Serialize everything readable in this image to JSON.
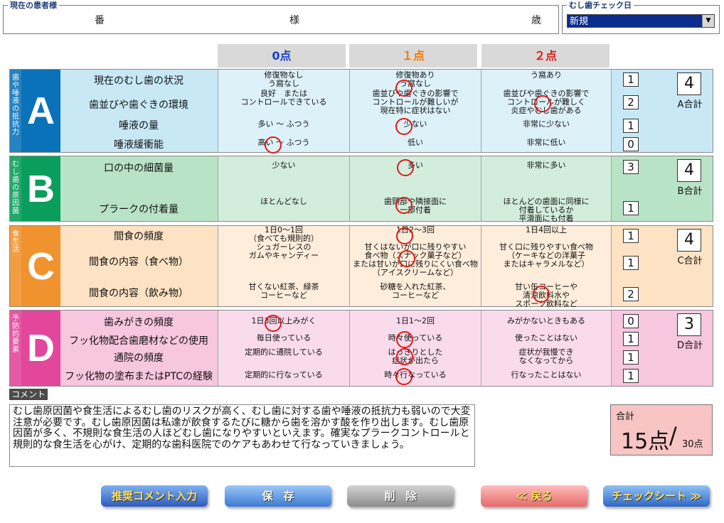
{
  "patient": {
    "legend": "現在の患者様",
    "number_suffix": "番",
    "name_suffix": "様",
    "age_suffix": "歳"
  },
  "check_date": {
    "legend": "むし歯チェック日",
    "selected": "新規"
  },
  "columns": {
    "zero": "0点",
    "one": "１点",
    "two": "２点",
    "zero_color": "#1a3ec2",
    "one_color": "#f07800",
    "two_color": "#e01818"
  },
  "sections": [
    {
      "letter": "A",
      "vertical_label": "歯や唾液の抵抗力",
      "label_color": "#0a72b8",
      "bg_color": "#c8e8f6",
      "items": [
        "現在のむし歯の状況",
        "歯並びや歯ぐきの環境",
        "唾液の量",
        "唾液緩衝能"
      ],
      "options": [
        [
          "修復物なし\nう窩なし",
          "修復物あり\nう窩なし",
          "う窩あり"
        ],
        [
          "良好　または\nコントロールできている",
          "歯並びや歯ぐきの影響で\nコントロールが難しいが\n現在特に症状はない",
          "歯並びや歯ぐきの影響で\nコントロールが難しく\n炎症やむし歯がある"
        ],
        [
          "多い ～ ふつう",
          "少ない",
          "非常に少ない"
        ],
        [
          "高い ～ ふつう",
          "低い",
          "非常に低い"
        ]
      ],
      "scores": [
        "1",
        "2",
        "1",
        "0"
      ],
      "total": "4",
      "total_label": "A合計"
    },
    {
      "letter": "B",
      "vertical_label": "むし歯の原因菌",
      "label_color": "#0a9e5c",
      "bg_color": "#b9e3c7",
      "items": [
        "口の中の細菌量",
        "プラークの付着量"
      ],
      "options": [
        [
          "少ない",
          "多い",
          "非常に多い"
        ],
        [
          "ほとんどなし",
          "歯頸部や隣接面に\n一部付着",
          "ほとんどの歯面に同様に\n付着しているか\n平滑面にも付着"
        ]
      ],
      "scores": [
        "3",
        "1"
      ],
      "total": "4",
      "total_label": "B合計"
    },
    {
      "letter": "C",
      "vertical_label": "食生活",
      "label_color": "#f0922e",
      "bg_color": "#fde2c4",
      "items": [
        "間食の頻度",
        "間食の内容（食べ物）",
        "間食の内容（飲み物）"
      ],
      "options": [
        [
          "1日0～1回\n（食べても規則的）",
          "1日2～3回",
          "1日4回以上"
        ],
        [
          "シュガーレスの\nガムやキャンディー",
          "甘くはないが口に残りやすい\n食べ物（スナック菓子など）\nまたは甘いが口に残りにくい食べ物\n（アイスクリームなど）",
          "甘く口に残りやすい食べ物\n（ケーキなどの洋菓子\nまたはキャラメルなど）"
        ],
        [
          "甘くない紅茶、緑茶\nコーヒーなど",
          "砂糖を入れた紅茶、\nコーヒーなど",
          "甘い缶コーヒーや\n清涼飲料水や\nスポーツ飲料など"
        ]
      ],
      "scores": [
        "1",
        "1",
        "2"
      ],
      "total": "4",
      "total_label": "C合計"
    },
    {
      "letter": "D",
      "vertical_label": "予防的要素",
      "label_color": "#e2479c",
      "bg_color": "#f7c6df",
      "items": [
        "歯みがきの頻度",
        "フッ化物配合歯磨材などの使用",
        "通院の頻度",
        "フッ化物の塗布またはPTCの経験"
      ],
      "options": [
        [
          "1日3回以上みがく",
          "1日1～2回",
          "みがかないときもある"
        ],
        [
          "毎日使っている",
          "時々使っている",
          "使ったことはない"
        ],
        [
          "定期的に通院している",
          "はっきりとした\n症状が出たら",
          "症状が我慢でき\nなくなってから"
        ],
        [
          "定期的に行なっている",
          "時々行なっている",
          "行なったことはない"
        ]
      ],
      "scores": [
        "0",
        "1",
        "1",
        "1"
      ],
      "total": "3",
      "total_label": "D合計"
    }
  ],
  "comment": {
    "label": "コメント",
    "text": "むし歯原因菌や食生活によるむし歯のリスクが高く、むし歯に対する歯や唾液の抵抗力も弱いので大変注意が必要です。むし歯原因菌は私達が飲食するたびに糖から歯を溶かす酸を作り出します。むし歯原因菌が多く、不規則な食生活の人ほどむし歯になりやすいといえます。確実なプラークコントロールと規則的な食生活を心がけ、定期的な歯科医院でのケアもあわせて行なっていきましょう。"
  },
  "total": {
    "label": "合計",
    "value": "15点",
    "slash": "/",
    "max": "30点"
  },
  "buttons": {
    "recommend": "推奨コメント入力",
    "save": "保　存",
    "delete": "削　除",
    "back": "≪ 戻る",
    "checksheet": "チェックシート ≫"
  }
}
